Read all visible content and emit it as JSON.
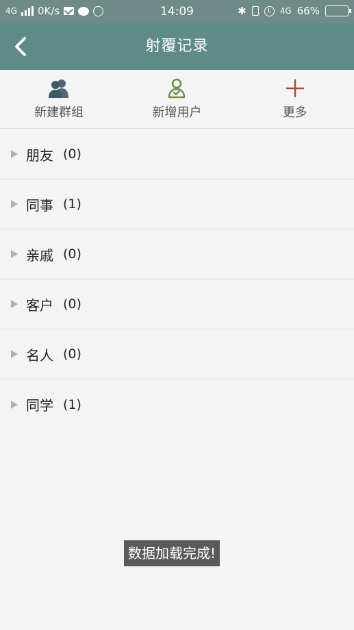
{
  "status_bar": {
    "network": "4G",
    "speed": "0K/s",
    "time": "14:09",
    "network_right": "4G",
    "battery": "66%",
    "battery_level": 0.66,
    "icons": [
      "signal-icon",
      "mail-icon",
      "chat-icon",
      "circle-icon",
      "bluetooth-icon",
      "vibrate-icon",
      "alarm-icon",
      "battery-icon"
    ]
  },
  "header": {
    "title": "射覆记录",
    "back_icon": "back-arrow-icon"
  },
  "toolbar": {
    "items": [
      {
        "label": "新建群组",
        "icon": "group-icon",
        "color": "#3e5a66"
      },
      {
        "label": "新增用户",
        "icon": "add-user-icon",
        "color": "#6f8c4f"
      },
      {
        "label": "更多",
        "icon": "plus-icon",
        "color": "#b24a36"
      }
    ]
  },
  "groups": [
    {
      "name": "朋友",
      "count": "(0)"
    },
    {
      "name": "同事",
      "count": "(1)"
    },
    {
      "name": "亲戚",
      "count": "(0)"
    },
    {
      "name": "客户",
      "count": "(0)"
    },
    {
      "name": "名人",
      "count": "(0)"
    },
    {
      "name": "同学",
      "count": "(1)"
    }
  ],
  "toast": {
    "text": "数据加载完成!"
  },
  "colors": {
    "header_bg": "#5f8b87",
    "status_bg": "#6e8b88",
    "page_bg": "#f4f4f4"
  }
}
